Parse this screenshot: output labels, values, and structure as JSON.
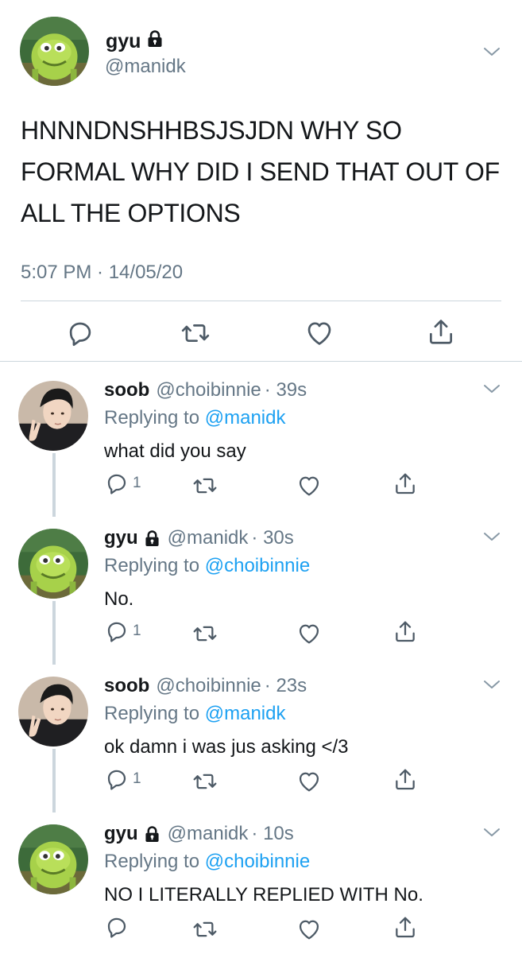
{
  "main_tweet": {
    "display_name": "gyu",
    "handle": "@manidk",
    "text": "HNNNDNSHHBSJSJDN WHY SO FORMAL WHY DID I SEND THAT OUT OF ALL THE OPTIONS",
    "timestamp": "5:07 PM · 14/05/20",
    "protected_icon": "lock-icon",
    "menu_icon": "chevron-down-icon",
    "actions": [
      "reply-icon",
      "retweet-icon",
      "like-icon",
      "share-icon"
    ]
  },
  "replies": [
    {
      "display_name": "soob",
      "handle": "@choibinnie",
      "time": "· 39s",
      "replying_prefix": "Replying to",
      "replying_to": "@manidk",
      "text": "what did you say",
      "reply_count": "1",
      "protected": false
    },
    {
      "display_name": "gyu",
      "handle": "@manidk",
      "time": "· 30s",
      "replying_prefix": "Replying to",
      "replying_to": "@choibinnie",
      "text": "No.",
      "reply_count": "1",
      "protected": true
    },
    {
      "display_name": "soob",
      "handle": "@choibinnie",
      "time": "· 23s",
      "replying_prefix": "Replying to",
      "replying_to": "@manidk",
      "text": "ok damn i was jus asking </3",
      "reply_count": "1",
      "protected": false
    },
    {
      "display_name": "gyu",
      "handle": "@manidk",
      "time": "· 10s",
      "replying_prefix": "Replying to",
      "replying_to": "@choibinnie",
      "text": "NO I LITERALLY REPLIED WITH No.",
      "reply_count": "",
      "protected": true
    }
  ],
  "colors": {
    "text": "#14171a",
    "secondary": "#657786",
    "link": "#1da1f2",
    "divider": "#ccd6dd"
  }
}
